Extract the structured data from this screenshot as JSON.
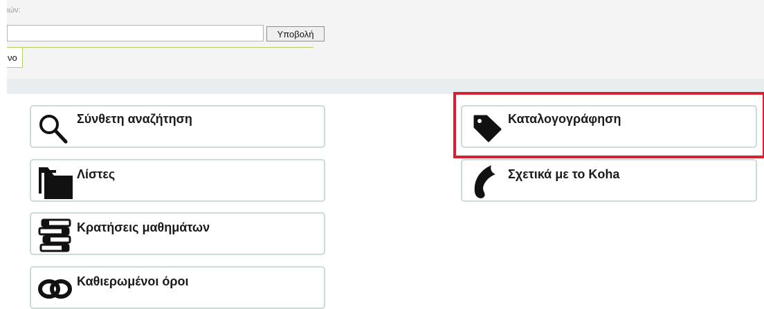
{
  "search": {
    "label": "ιών:",
    "input_value": "",
    "submit_label": "Υποβολή"
  },
  "tab": {
    "label": "νο"
  },
  "tiles": [
    {
      "label": "Σύνθετη αναζήτηση",
      "icon": "magnifier-icon"
    },
    {
      "label": "Λίστες",
      "icon": "folders-icon"
    },
    {
      "label": "Κρατήσεις μαθημάτων",
      "icon": "books-icon"
    },
    {
      "label": "Καθιερωμένοι όροι",
      "icon": "chain-link-icon"
    },
    {
      "label": "Καταλογογράφηση",
      "icon": "tag-icon"
    },
    {
      "label": "Σχετικά με το Koha",
      "icon": "koha-logo-icon"
    }
  ],
  "highlight": {
    "color": "#d42233",
    "target": "Καταλογογράφηση"
  },
  "colors": {
    "tile_border": "#c9dcd9",
    "tab_accent": "#b1d05c",
    "header_bg": "#f4f4f4",
    "divider_bg": "#e8eef0"
  }
}
